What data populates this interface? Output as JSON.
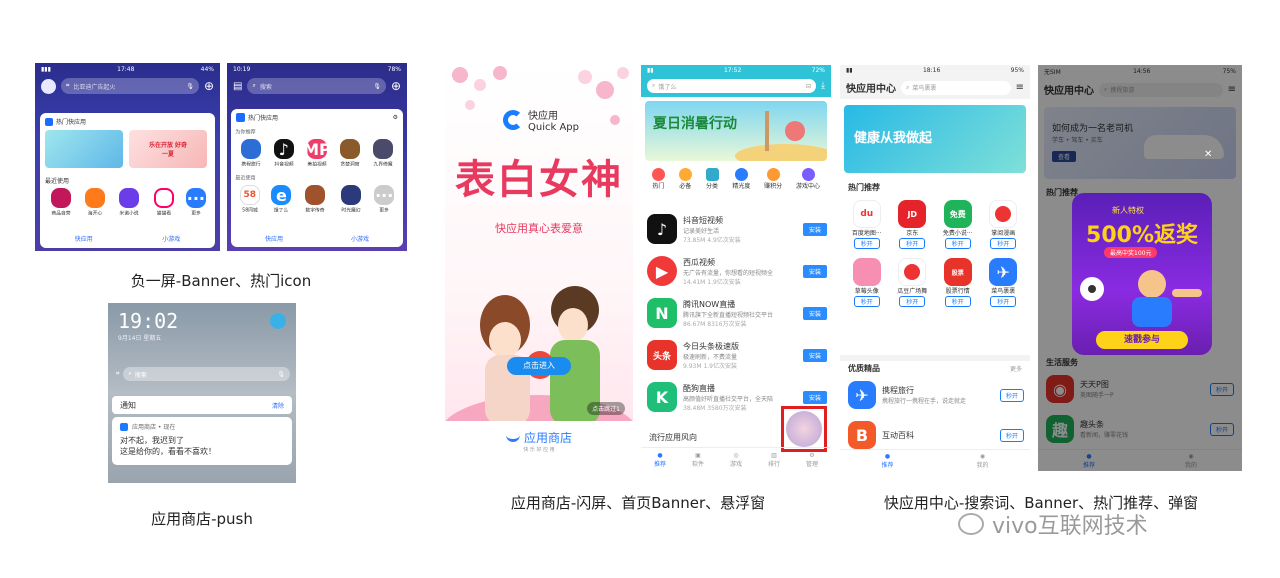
{
  "captions": {
    "shot1": "负一屏-Banner、热门icon",
    "shot2": "应用商店-push",
    "shot3": "应用商店-闪屏、首页Banner、悬浮窗",
    "shot4": "快应用中心-搜索词、Banner、热门推荐、弹窗"
  },
  "watermark": "vivo互联网技术",
  "minus_screen_a": {
    "time": "17:48",
    "battery": "44%",
    "search_placeholder": "比亚迪广告起火",
    "section_title": "热门快应用",
    "recent_title": "最近使用",
    "apps": [
      "商品自营",
      "海开心",
      "米诺小说",
      "猫猫看",
      "更多"
    ],
    "tabs": [
      "快应用",
      "小游戏"
    ],
    "banner_text": "乐在开放 好奇一夏"
  },
  "minus_screen_b": {
    "time": "10:19",
    "battery": "78%",
    "search_placeholder": "搜索",
    "section_title": "热门快应用",
    "group1": "为你推荐",
    "apps1": [
      "携程旅行",
      "抖音视频",
      "美拍视频",
      "贪婪洞窟",
      "九界倚魔"
    ],
    "group2": "最近使用",
    "apps2": [
      "58同城",
      "饿了么",
      "数字传奇",
      "时光魔幻",
      "更多"
    ],
    "tabs": [
      "快应用",
      "小游戏"
    ]
  },
  "push_screen": {
    "clock": "19:02",
    "date": "9月14日 星期五",
    "search_placeholder": "搜索",
    "notice_label": "通知",
    "clear_label": "清除",
    "source": "应用商店 • 现在",
    "line1": "对不起，我迟到了",
    "line2": "这是给你的，看看不喜欢！"
  },
  "splash_screen": {
    "logo_name": "快应用",
    "logo_sub": "Quick App",
    "headline": "表白女神",
    "slogan": "快应用真心表爱意",
    "enter_button": "点击进入",
    "skip_label": "点击跳过1",
    "store_name": "应用商店",
    "store_sub": "快 乐 好 应 用"
  },
  "store_home": {
    "time": "17:52",
    "battery": "72%",
    "search_placeholder": "饿了么",
    "banner_title": "夏日消暑行动",
    "categories": [
      "热门",
      "必备",
      "分类",
      "精光度",
      "赚积分",
      "游戏中心"
    ],
    "apps": [
      {
        "name": "抖音短视频",
        "desc": "记录美好生活",
        "meta": "73.85M  4.9亿次安装",
        "btn": "安装"
      },
      {
        "name": "西瓜视频",
        "desc": "无广告有流量，你想看的短视频全",
        "meta": "14.41M  1.9亿次安装",
        "btn": "安装"
      },
      {
        "name": "腾讯NOW直播",
        "desc": "腾讯旗下全新直播短视频社交平台",
        "meta": "86.67M  8316万次安装",
        "btn": "安装"
      },
      {
        "name": "今日头条极速版",
        "desc": "极速刷新，不费流量",
        "meta": "9.93M  1.9亿次安装",
        "btn": "安装"
      },
      {
        "name": "酷狗直播",
        "desc": "高颜值好听直播社交平台，全天陪",
        "meta": "38.48M  3580万次安装",
        "btn": "安装"
      }
    ],
    "trend_label": "流行应用风向",
    "tabs": [
      "推荐",
      "软件",
      "游戏",
      "排行",
      "管理"
    ]
  },
  "quick_center_a": {
    "time": "18:16",
    "battery": "95%",
    "title": "快应用中心",
    "search_placeholder": "菜鸟裹裹",
    "banner_text": "健康从我做起",
    "hot_title": "热门推荐",
    "hot_apps": [
      "百度地图···",
      "京东",
      "免费小说···",
      "掌阅漫画",
      "草莓头像",
      "瓜豆广场舞",
      "股票行情",
      "菜鸟裹裹"
    ],
    "open_label": "秒开",
    "boutique_title": "优质精品",
    "more_label": "更多",
    "boutique_apps": [
      {
        "name": "携程旅行",
        "desc": "携程旅行一携程在手，说走就走"
      },
      {
        "name": "互动百科",
        "desc": ""
      }
    ],
    "tabs": [
      "推荐",
      "我的"
    ]
  },
  "quick_center_b": {
    "carrier": "无SIM",
    "time": "14:56",
    "battery": "75%",
    "title": "快应用中心",
    "search_placeholder": "携程旅游",
    "banner_title": "如何成为一名老司机",
    "banner_sub": "学车 • 驾车 • 买车",
    "banner_btn": "查看",
    "hot_title": "热门推荐",
    "popup_tag": "新人特权",
    "popup_main": "500%返奖",
    "popup_sub": "最高中奖100元",
    "popup_btn": "速戳参与",
    "life_title": "生活服务",
    "life_apps": [
      {
        "name": "天天P图",
        "desc": "美图随手一P"
      },
      {
        "name": "趣头条",
        "desc": "看新闻，赚零花钱"
      }
    ],
    "open_label": "秒开",
    "tabs": [
      "推荐",
      "我的"
    ]
  }
}
